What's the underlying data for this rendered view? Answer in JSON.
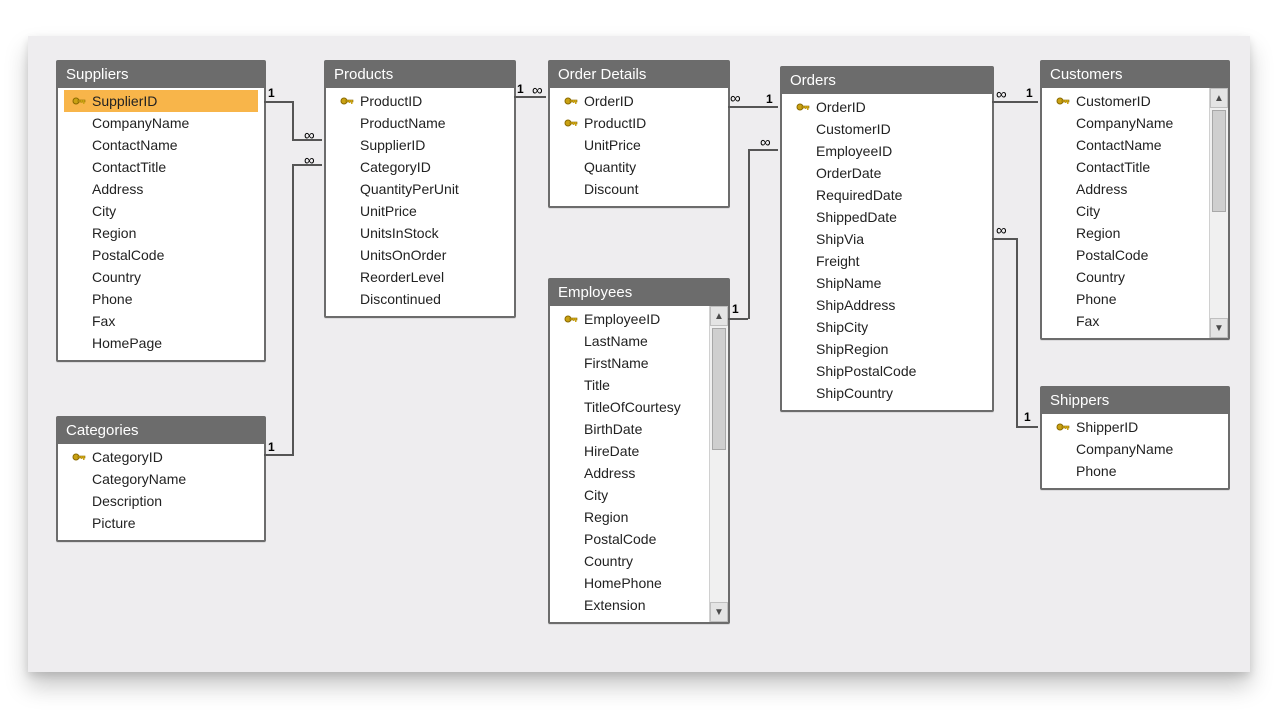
{
  "tables": {
    "suppliers": {
      "title": "Suppliers",
      "columns": [
        {
          "name": "SupplierID",
          "pk": true,
          "selected": true
        },
        {
          "name": "CompanyName"
        },
        {
          "name": "ContactName"
        },
        {
          "name": "ContactTitle"
        },
        {
          "name": "Address"
        },
        {
          "name": "City"
        },
        {
          "name": "Region"
        },
        {
          "name": "PostalCode"
        },
        {
          "name": "Country"
        },
        {
          "name": "Phone"
        },
        {
          "name": "Fax"
        },
        {
          "name": "HomePage"
        }
      ]
    },
    "categories": {
      "title": "Categories",
      "columns": [
        {
          "name": "CategoryID",
          "pk": true
        },
        {
          "name": "CategoryName"
        },
        {
          "name": "Description"
        },
        {
          "name": "Picture"
        }
      ]
    },
    "products": {
      "title": "Products",
      "columns": [
        {
          "name": "ProductID",
          "pk": true
        },
        {
          "name": "ProductName"
        },
        {
          "name": "SupplierID"
        },
        {
          "name": "CategoryID"
        },
        {
          "name": "QuantityPerUnit"
        },
        {
          "name": "UnitPrice"
        },
        {
          "name": "UnitsInStock"
        },
        {
          "name": "UnitsOnOrder"
        },
        {
          "name": "ReorderLevel"
        },
        {
          "name": "Discontinued"
        }
      ]
    },
    "order_details": {
      "title": "Order Details",
      "columns": [
        {
          "name": "OrderID",
          "pk": true
        },
        {
          "name": "ProductID",
          "pk": true
        },
        {
          "name": "UnitPrice"
        },
        {
          "name": "Quantity"
        },
        {
          "name": "Discount"
        }
      ]
    },
    "employees": {
      "title": "Employees",
      "columns": [
        {
          "name": "EmployeeID",
          "pk": true
        },
        {
          "name": "LastName"
        },
        {
          "name": "FirstName"
        },
        {
          "name": "Title"
        },
        {
          "name": "TitleOfCourtesy"
        },
        {
          "name": "BirthDate"
        },
        {
          "name": "HireDate"
        },
        {
          "name": "Address"
        },
        {
          "name": "City"
        },
        {
          "name": "Region"
        },
        {
          "name": "PostalCode"
        },
        {
          "name": "Country"
        },
        {
          "name": "HomePhone"
        },
        {
          "name": "Extension"
        }
      ]
    },
    "orders": {
      "title": "Orders",
      "columns": [
        {
          "name": "OrderID",
          "pk": true
        },
        {
          "name": "CustomerID"
        },
        {
          "name": "EmployeeID"
        },
        {
          "name": "OrderDate"
        },
        {
          "name": "RequiredDate"
        },
        {
          "name": "ShippedDate"
        },
        {
          "name": "ShipVia"
        },
        {
          "name": "Freight"
        },
        {
          "name": "ShipName"
        },
        {
          "name": "ShipAddress"
        },
        {
          "name": "ShipCity"
        },
        {
          "name": "ShipRegion"
        },
        {
          "name": "ShipPostalCode"
        },
        {
          "name": "ShipCountry"
        }
      ]
    },
    "customers": {
      "title": "Customers",
      "columns": [
        {
          "name": "CustomerID",
          "pk": true
        },
        {
          "name": "CompanyName"
        },
        {
          "name": "ContactName"
        },
        {
          "name": "ContactTitle"
        },
        {
          "name": "Address"
        },
        {
          "name": "City"
        },
        {
          "name": "Region"
        },
        {
          "name": "PostalCode"
        },
        {
          "name": "Country"
        },
        {
          "name": "Phone"
        },
        {
          "name": "Fax"
        }
      ]
    },
    "shippers": {
      "title": "Shippers",
      "columns": [
        {
          "name": "ShipperID",
          "pk": true
        },
        {
          "name": "CompanyName"
        },
        {
          "name": "Phone"
        }
      ]
    }
  },
  "relationships": [
    {
      "from": "suppliers.SupplierID",
      "to": "products.SupplierID",
      "card": "1:∞"
    },
    {
      "from": "categories.CategoryID",
      "to": "products.CategoryID",
      "card": "1:∞"
    },
    {
      "from": "products.ProductID",
      "to": "order_details.ProductID",
      "card": "1:∞"
    },
    {
      "from": "orders.OrderID",
      "to": "order_details.OrderID",
      "card": "1:∞"
    },
    {
      "from": "employees.EmployeeID",
      "to": "orders.EmployeeID",
      "card": "1:∞"
    },
    {
      "from": "customers.CustomerID",
      "to": "orders.CustomerID",
      "card": "1:∞"
    },
    {
      "from": "shippers.ShipperID",
      "to": "orders.ShipVia",
      "card": "1:∞"
    }
  ],
  "cardinality_labels": {
    "one": "1",
    "many": "∞"
  }
}
